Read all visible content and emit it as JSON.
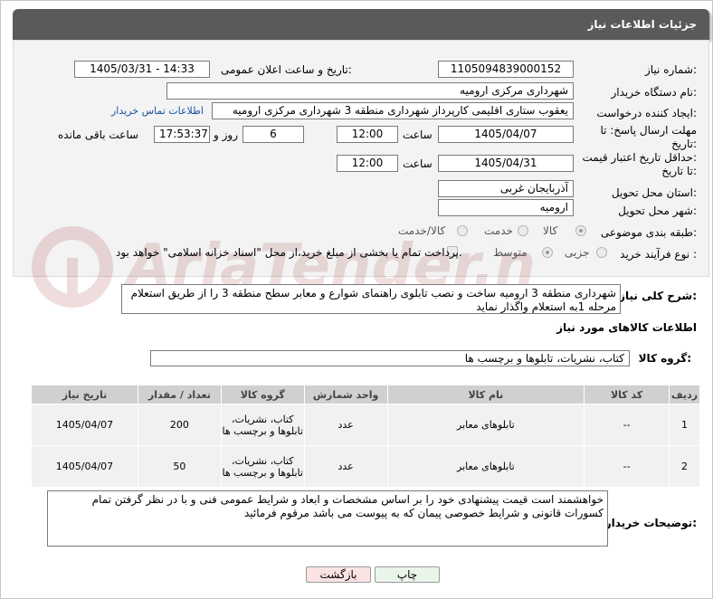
{
  "header": {
    "title": "جزئیات اطلاعات نیاز"
  },
  "fields": {
    "need_number_label": "شماره نیاز:",
    "need_number": "1105094839000152",
    "announce_label": "تاریخ و ساعت اعلان عمومی:",
    "announce_value": "1405/03/31 - 14:33",
    "buyer_org_label": "نام دستگاه خریدار:",
    "buyer_org": "شهرداری مرکزی ارومیه",
    "requester_label": "ایجاد کننده درخواست:",
    "requester": "یعقوب ستاری اقلیمی کارپرداز شهرداری منطقه 3 شهرداری مرکزی ارومیه",
    "contact_link": "اطلاعات تماس خریدار",
    "deadline_label_1": "مهلت ارسال پاسخ: تا",
    "deadline_label_2": "تاریخ:",
    "deadline_date": "1405/04/07",
    "time_label": "ساعت",
    "deadline_time": "12:00",
    "days_value": "6",
    "days_label": "روز و",
    "remaining_time": "17:53:37",
    "remaining_label": "ساعت باقی مانده",
    "validity_label_1": "حداقل تاریخ اعتبار قیمت:",
    "validity_label_2": "تا تاریخ:",
    "validity_date": "1405/04/31",
    "validity_time_label": "ساعت",
    "validity_time": "12:00",
    "province_label": "استان محل تحویل:",
    "province": "آذربایجان غربی",
    "city_label": "شهر محل تحویل:",
    "city": "ارومیه",
    "category_label": "طبقه بندی موضوعی:",
    "category_options": [
      "کالا",
      "خدمت",
      "کالا/خدمت"
    ],
    "category_selected": "کالا",
    "process_label": "نوع فرآیند خرید :",
    "process_options": [
      "جزیی",
      "متوسط"
    ],
    "process_selected": "متوسط",
    "payment_note": "پرداخت تمام یا بخشی از مبلغ خرید،از محل \"اسناد خزانه اسلامی\" خواهد بود."
  },
  "summary": {
    "label": "شرح کلی نیاز:",
    "text": "شهرداری منطقه 3 ارومیه ساخت و نصب تابلوی راهنمای شوارع و معابر  سطح منطقه 3 را از طریق استعلام مرحله 1به استعلام واگذار نماید"
  },
  "goods": {
    "title": "اطلاعات کالاهای مورد نیاز",
    "group_label": "گروه کالا:",
    "group_value": "کتاب، نشریات، تابلوها و برچسب ها",
    "columns": [
      "ردیف",
      "کد کالا",
      "نام کالا",
      "واحد شمارش",
      "گروه کالا",
      "تعداد / مقدار",
      "تاریخ نیاز"
    ],
    "rows": [
      {
        "row": "1",
        "code": "--",
        "name": "تابلوهای معابر",
        "unit": "عدد",
        "group": "کتاب، نشریات، تابلوها و برچسب ها",
        "qty": "200",
        "date": "1405/04/07"
      },
      {
        "row": "2",
        "code": "--",
        "name": "تابلوهای معابر",
        "unit": "عدد",
        "group": "کتاب، نشریات، تابلوها و برچسب ها",
        "qty": "50",
        "date": "1405/04/07"
      }
    ]
  },
  "buyer_notes": {
    "label": "توضیحات خریدار:",
    "text": "خواهشمند است قیمت پیشنهادی خود را بر اساس مشخصات و ابعاد و شرایط عمومی فنی و با در نظر گرفتن تمام کسورات قانونی و شرایط خصوصی پیمان که به پیوست می باشد مرقوم فرمائید"
  },
  "buttons": {
    "print": "چاپ",
    "back": "بازگشت"
  },
  "watermark": "AriaTender.net",
  "colors": {
    "header_bg": "#5a5a5a",
    "print_btn": "#eaf5ea",
    "back_btn": "#fbe3e3",
    "link": "#1a4fa0"
  }
}
